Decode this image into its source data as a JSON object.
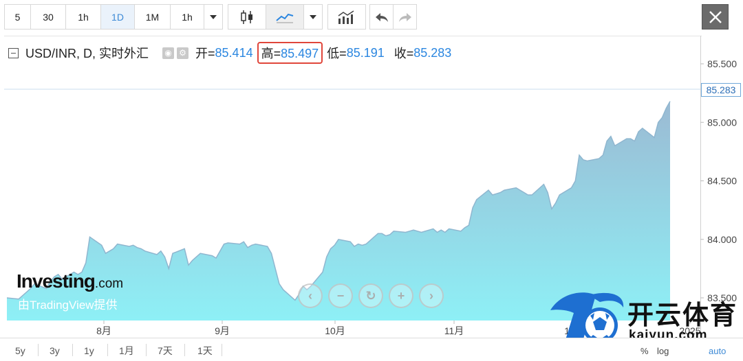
{
  "toolbar": {
    "intervals": [
      "5",
      "30",
      "1h",
      "1D",
      "1M",
      "1h"
    ],
    "active_interval": "1D",
    "icons": [
      "dropdown-arrow-icon",
      "candlestick-icon",
      "line-chart-icon",
      "dropdown-arrow-icon",
      "indicators-icon",
      "undo-icon",
      "redo-icon",
      "close-icon"
    ]
  },
  "legend": {
    "symbol": "USD/INR, D, 实时外汇",
    "open_label": "开=",
    "open_value": "85.414",
    "high_label": "高=",
    "high_value": "85.497",
    "low_label": "低=",
    "low_value": "85.191",
    "close_label": "收=",
    "close_value": "85.283"
  },
  "price_tag": "85.283",
  "watermark": {
    "brand": "Investing",
    "brand_suffix": ".com",
    "powered": "由TradingView提供"
  },
  "overlay_logo": {
    "text": "开云体育",
    "url": "kaiyun.com"
  },
  "bottom": {
    "ranges": [
      "5y",
      "3y",
      "1y",
      "1月",
      "7天",
      "1天"
    ],
    "scales": [
      "%",
      "log",
      "auto"
    ]
  },
  "colors": {
    "area_top": "#9bbad3",
    "area_bottom": "#8ef0f6",
    "line": "#8fb6cf",
    "accent": "#2a86e0",
    "highlight_box": "#e0453a"
  },
  "chart_data": {
    "type": "area",
    "title": "USD/INR, D, 实时外汇",
    "y_ticks": [
      "83.500",
      "84.000",
      "84.500",
      "85.000",
      "85.500"
    ],
    "x_ticks": [
      "8月",
      "9月",
      "10月",
      "11月",
      "12月",
      "2025"
    ],
    "ylim": [
      83.4,
      85.6
    ],
    "last_price": 85.283,
    "x": [
      "07-12",
      "07-15",
      "07-16",
      "07-17",
      "07-18",
      "07-19",
      "07-22",
      "07-23",
      "07-24",
      "07-25",
      "07-26",
      "07-29",
      "07-30",
      "07-31",
      "08-01",
      "08-02",
      "08-05",
      "08-06",
      "08-07",
      "08-08",
      "08-09",
      "08-12",
      "08-13",
      "08-14",
      "08-15",
      "08-16",
      "08-19",
      "08-20",
      "08-21",
      "08-22",
      "08-23",
      "08-26",
      "08-27",
      "08-28",
      "08-29",
      "08-30",
      "09-02",
      "09-03",
      "09-04",
      "09-05",
      "09-06",
      "09-09",
      "09-10",
      "09-11",
      "09-12",
      "09-13",
      "09-16",
      "09-17",
      "09-18",
      "09-19",
      "09-20",
      "09-23",
      "09-24",
      "09-25",
      "09-26",
      "09-27",
      "09-30",
      "10-01",
      "10-02",
      "10-03",
      "10-04",
      "10-07",
      "10-08",
      "10-09",
      "10-10",
      "10-11",
      "10-14",
      "10-15",
      "10-16",
      "10-17",
      "10-18",
      "10-21",
      "10-22",
      "10-23",
      "10-24",
      "10-25",
      "10-28",
      "10-29",
      "10-30",
      "10-31",
      "11-01",
      "11-04",
      "11-05",
      "11-06",
      "11-07",
      "11-08",
      "11-11",
      "11-12",
      "11-13",
      "11-14",
      "11-15",
      "11-18",
      "11-19",
      "11-20",
      "11-21",
      "11-22",
      "11-25",
      "11-26",
      "11-27",
      "11-28",
      "11-29",
      "12-02",
      "12-03",
      "12-04",
      "12-05",
      "12-06",
      "12-09",
      "12-10",
      "12-11",
      "12-12",
      "12-13",
      "12-16",
      "12-17",
      "12-18",
      "12-19",
      "12-20",
      "12-23",
      "12-24",
      "12-25",
      "12-26",
      "12-27"
    ],
    "values": [
      83.5,
      83.49,
      83.52,
      83.55,
      83.58,
      83.62,
      83.58,
      83.64,
      83.68,
      83.7,
      83.66,
      83.72,
      83.7,
      83.72,
      83.8,
      84.02,
      83.95,
      83.88,
      83.9,
      83.92,
      83.96,
      83.94,
      83.95,
      83.93,
      83.92,
      83.9,
      83.87,
      83.9,
      83.85,
      83.75,
      83.88,
      83.92,
      83.78,
      83.82,
      83.85,
      83.88,
      83.86,
      83.84,
      83.9,
      83.96,
      83.97,
      83.96,
      83.98,
      83.93,
      83.95,
      83.96,
      83.94,
      83.88,
      83.75,
      83.62,
      83.57,
      83.48,
      83.53,
      83.6,
      83.57,
      83.6,
      83.72,
      83.85,
      83.92,
      83.95,
      84.0,
      83.98,
      83.94,
      83.96,
      83.95,
      83.96,
      84.05,
      84.05,
      84.03,
      84.04,
      84.07,
      84.06,
      84.07,
      84.08,
      84.07,
      84.06,
      84.09,
      84.06,
      84.08,
      84.06,
      84.09,
      84.07,
      84.1,
      84.12,
      84.27,
      84.34,
      84.42,
      84.38,
      84.39,
      84.4,
      84.42,
      84.44,
      84.42,
      84.4,
      84.38,
      84.38,
      84.47,
      84.4,
      84.26,
      84.31,
      84.38,
      84.44,
      84.5,
      84.72,
      84.68,
      84.67,
      84.69,
      84.72,
      84.84,
      84.88,
      84.8,
      84.86,
      84.86,
      84.84,
      84.92,
      84.95,
      84.87,
      85.0,
      85.04,
      85.12,
      85.18,
      85.22,
      85.283
    ]
  }
}
